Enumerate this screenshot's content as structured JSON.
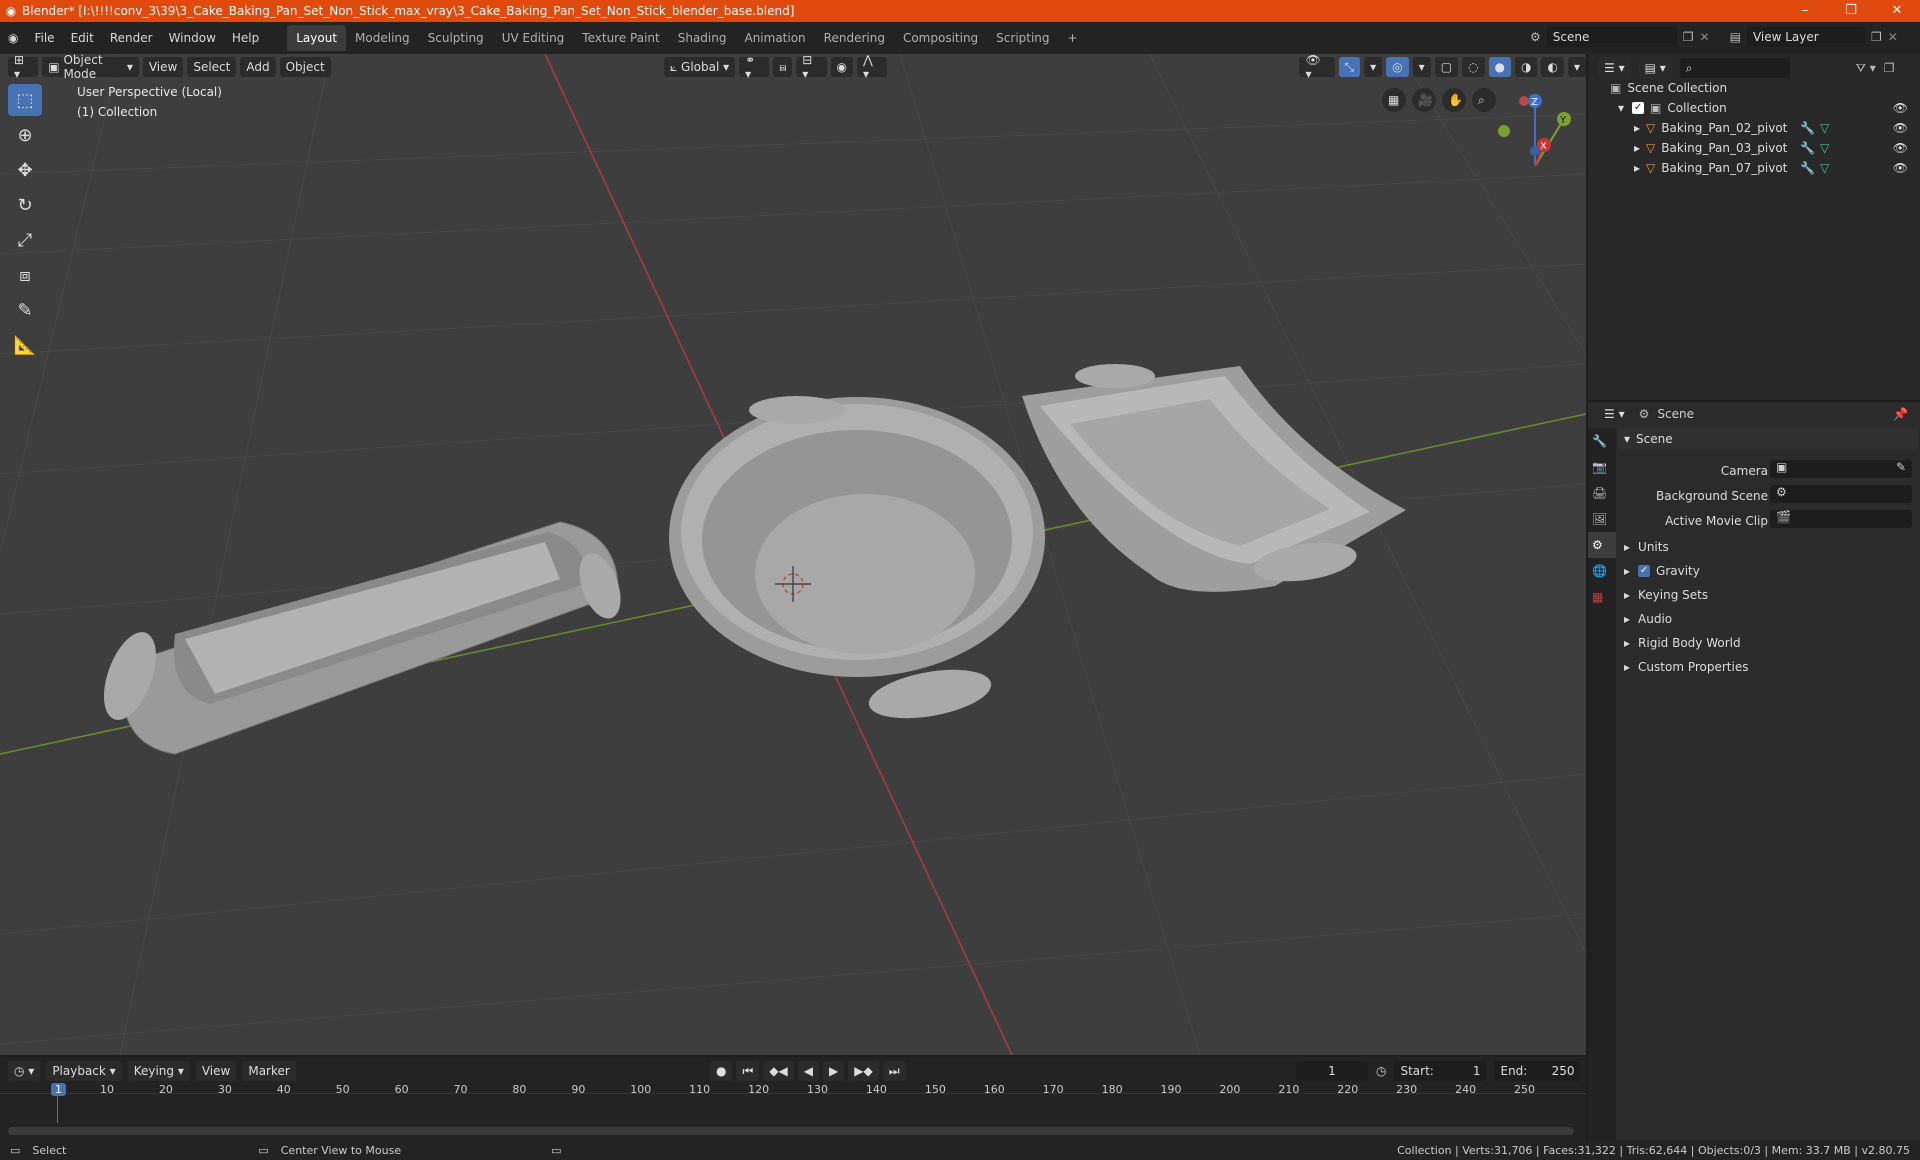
{
  "window": {
    "title": "Blender* [I:\\!!!!conv_3\\39\\3_Cake_Baking_Pan_Set_Non_Stick_max_vray\\3_Cake_Baking_Pan_Set_Non_Stick_blender_base.blend]"
  },
  "menu": {
    "file": "File",
    "edit": "Edit",
    "render": "Render",
    "window": "Window",
    "help": "Help"
  },
  "workspaces": [
    "Layout",
    "Modeling",
    "Sculpting",
    "UV Editing",
    "Texture Paint",
    "Shading",
    "Animation",
    "Rendering",
    "Compositing",
    "Scripting"
  ],
  "scene": {
    "name": "Scene",
    "view_layer": "View Layer"
  },
  "viewport": {
    "mode": "Object Mode",
    "menu_view": "View",
    "menu_select": "Select",
    "menu_add": "Add",
    "menu_object": "Object",
    "transform": "Global",
    "perspective": "User Perspective (Local)",
    "collection": "(1) Collection"
  },
  "outliner": {
    "root": "Scene Collection",
    "collection": "Collection",
    "items": [
      "Baking_Pan_02_pivot",
      "Baking_Pan_03_pivot",
      "Baking_Pan_07_pivot"
    ]
  },
  "properties": {
    "tab": "Scene",
    "section": "Scene",
    "camera": "Camera",
    "background_scene": "Background Scene",
    "active_movie_clip": "Active Movie Clip",
    "panels": [
      "Units",
      "Gravity",
      "Keying Sets",
      "Audio",
      "Rigid Body World",
      "Custom Properties"
    ]
  },
  "timeline": {
    "playback": "Playback",
    "keying": "Keying",
    "view": "View",
    "marker": "Marker",
    "current_frame": "1",
    "start_label": "Start:",
    "start": "1",
    "end_label": "End:",
    "end": "250",
    "ticks": [
      "1",
      "10",
      "20",
      "30",
      "40",
      "50",
      "60",
      "70",
      "80",
      "90",
      "100",
      "110",
      "120",
      "130",
      "140",
      "150",
      "160",
      "170",
      "180",
      "190",
      "200",
      "210",
      "220",
      "230",
      "240",
      "250"
    ]
  },
  "status": {
    "select": "Select",
    "center": "Center View to Mouse",
    "stats": "Collection | Verts:31,706 | Faces:31,322 | Tris:62,644 | Objects:0/3 | Mem: 33.7 MB | v2.80.75"
  },
  "colors": {
    "title_bar": "#e04a0c",
    "accent": "#4772b3",
    "x_axis": "#c23b3b",
    "y_axis": "#7aa12f"
  }
}
